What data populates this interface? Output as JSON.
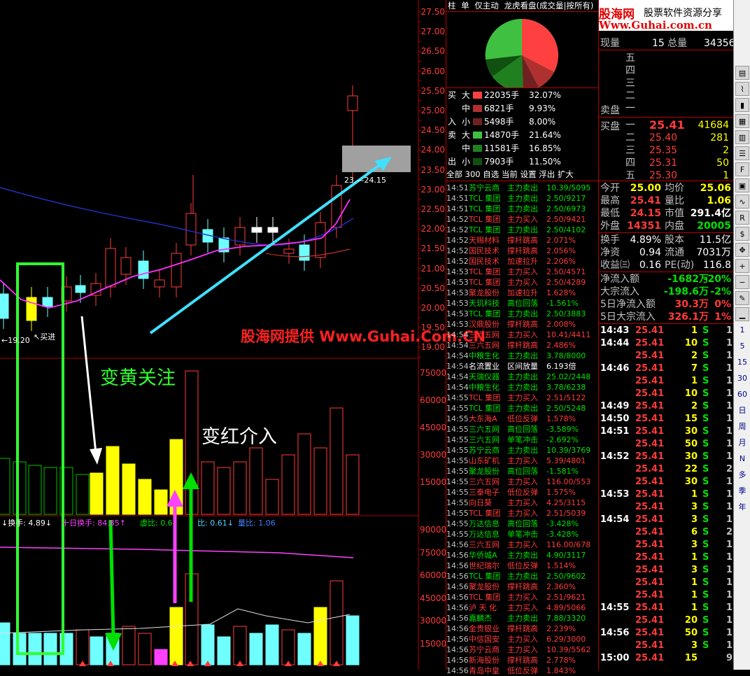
{
  "price_axis": [
    "27.50",
    "27.00",
    "26.50",
    "26.00",
    "25.50",
    "25.00",
    "24.50",
    "24.00",
    "23.50",
    "23.00",
    "22.50",
    "22.00",
    "21.50",
    "21.00",
    "20.50",
    "20.00",
    "19.50",
    "19.00"
  ],
  "vol_axis": [
    "75000",
    "60000",
    "45000",
    "30000",
    "15000"
  ],
  "turnover_axis": [
    "90000",
    "75000",
    "60000",
    "45000",
    "30000",
    "15000"
  ],
  "chart_labels": {
    "low_marker": "←19.20",
    "buy_marker": "↖买进",
    "range_label": "23.—24.15",
    "turnover_line": "↓换手: 4.89↓",
    "ten_day": "十日换手: 84.85↑",
    "xubi": "虚比: 0.6",
    "lbi": "比: 0.61↓",
    "liangbi": "量比: 1.06"
  },
  "annotations": {
    "yellow_note": "变黄关注",
    "red_note": "变红介入",
    "watermark": "股海网提供 Www.Guhai.Com.CN"
  },
  "logo": {
    "name": "股海网",
    "tagline": "股票软件资源分享",
    "url": "Www.Guhai.com.cn"
  },
  "mid_tabs": [
    "柱",
    "单",
    "仅主动",
    "龙虎看盘(成交量|按所有)"
  ],
  "flow": {
    "buy": [
      {
        "side": "买",
        "size": "大",
        "color": "#ff4040",
        "vol": "22035手",
        "pct": "32.07%"
      },
      {
        "side": "",
        "size": "中",
        "color": "#b03030",
        "vol": "6821手",
        "pct": "9.93%"
      },
      {
        "side": "入",
        "size": "小",
        "color": "#702020",
        "vol": "5498手",
        "pct": "8.00%"
      }
    ],
    "sell": [
      {
        "side": "卖",
        "size": "大",
        "color": "#40c040",
        "vol": "14870手",
        "pct": "21.64%"
      },
      {
        "side": "",
        "size": "中",
        "color": "#208020",
        "vol": "11581手",
        "pct": "16.85%"
      },
      {
        "side": "出",
        "size": "小",
        "color": "#105010",
        "vol": "7903手",
        "pct": "11.50%"
      }
    ]
  },
  "mid_bottom_tabs": [
    "全部",
    "300",
    "自选",
    "当前",
    "设置",
    "浮出",
    "扩大"
  ],
  "ticker": [
    [
      "14:51",
      "苏宁云商",
      "主力卖出",
      "10.39/5095",
      "g"
    ],
    [
      "14:51",
      "TCL 集团",
      "主力卖出",
      "2.50/9217",
      "g"
    ],
    [
      "14:51",
      "TCL 集团",
      "主力卖出",
      "2.50/6973",
      "g"
    ],
    [
      "14:52",
      "TCL 集团",
      "主力买入",
      "2.50/9421",
      "r"
    ],
    [
      "14:52",
      "TCL 集团",
      "主力卖出",
      "2.50/4102",
      "g"
    ],
    [
      "14:52",
      "天赐材料",
      "撑杆跳高",
      "2.071%",
      "r"
    ],
    [
      "14:52",
      "国民技术",
      "撑杆跳高",
      "2.056%",
      "r"
    ],
    [
      "14:52",
      "国民技术",
      "加速拉升",
      "2.206%",
      "r"
    ],
    [
      "14:53",
      "TCL 集团",
      "主力买入",
      "2.50/4571",
      "r"
    ],
    [
      "14:53",
      "TCL 集团",
      "主力买入",
      "2.50/4289",
      "r"
    ],
    [
      "14:53",
      "聚龙股份",
      "加速拉升",
      "1.628%",
      "r"
    ],
    [
      "14:53",
      "天玑科技",
      "高位回落",
      "-1.561%",
      "g"
    ],
    [
      "14:53",
      "TCL 集团",
      "主力卖出",
      "2.50/3883",
      "g"
    ],
    [
      "14:53",
      "汉鼎股份",
      "撑杆跳高",
      "2.008%",
      "r"
    ],
    [
      "14:54",
      "三六五网",
      "主力买入",
      "10.41/4411",
      "r"
    ],
    [
      "14:54",
      "三六五网",
      "撑杆跳高",
      "2.486%",
      "r"
    ],
    [
      "14:54",
      "中粮生化",
      "主力卖出",
      "3.78/8000",
      "g"
    ],
    [
      "14:54",
      "名流置业",
      "区间放量",
      "6.193倍",
      "w"
    ],
    [
      "14:54",
      "天瑞仪器",
      "主力卖出",
      "25.02/2448",
      "g"
    ],
    [
      "14:54",
      "中粮生化",
      "主力卖出",
      "3.78/6238",
      "g"
    ],
    [
      "14:55",
      "TCL 集团",
      "主力买入",
      "2.51/5122",
      "r"
    ],
    [
      "14:55",
      "TCL 集团",
      "主力卖出",
      "2.50/5248",
      "g"
    ],
    [
      "14:55",
      "大东海A",
      "低位反弹",
      "1.578%",
      "r"
    ],
    [
      "14:55",
      "三六五网",
      "高位回落",
      "-3.589%",
      "g"
    ],
    [
      "14:55",
      "三六五网",
      "单笔冲击",
      "-2.692%",
      "g"
    ],
    [
      "14:55",
      "苏宁云商",
      "主力卖出",
      "10.39/3769",
      "g"
    ],
    [
      "14:55",
      "山东矿机",
      "主力买入",
      "5.39/4801",
      "r"
    ],
    [
      "14:55",
      "聚龙股份",
      "高位回落",
      "-1.581%",
      "g"
    ],
    [
      "14:55",
      "三六五网",
      "主力买入",
      "116.00/553",
      "r"
    ],
    [
      "14:55",
      "三泰电子",
      "低位反弹",
      "1.575%",
      "r"
    ],
    [
      "14:55",
      "向日葵",
      "主力买入",
      "4.25/3115",
      "r"
    ],
    [
      "14:55",
      "TCL 集团",
      "主力买入",
      "2.51/5039",
      "r"
    ],
    [
      "14:55",
      "万达信息",
      "高位回落",
      "-3.428%",
      "g"
    ],
    [
      "14:55",
      "万达信息",
      "单笔冲击",
      "-3.428%",
      "g"
    ],
    [
      "14:56",
      "三六五网",
      "主力买入",
      "116.00/678",
      "r"
    ],
    [
      "14:56",
      "华侨城A",
      "主力卖出",
      "4.90/3117",
      "g"
    ],
    [
      "14:56",
      "世纪瑞尔",
      "低位反弹",
      "1.514%",
      "r"
    ],
    [
      "14:56",
      "TCL 集团",
      "主力卖出",
      "2.50/9602",
      "g"
    ],
    [
      "14:56",
      "聚龙股份",
      "撑杆跳高",
      "2.360%",
      "r"
    ],
    [
      "14:56",
      "TCL 集团",
      "主力买入",
      "2.51/9621",
      "r"
    ],
    [
      "14:56",
      "泸 天 化",
      "主力买入",
      "4.89/5066",
      "r"
    ],
    [
      "14:56",
      "嘉麟杰",
      "主力卖出",
      "7.88/3320",
      "g"
    ],
    [
      "14:56",
      "金贵银业",
      "撑杆跳高",
      "2.239%",
      "r"
    ],
    [
      "14:56",
      "中信国安",
      "主力买入",
      "6.29/3000",
      "r"
    ],
    [
      "14:56",
      "苏宁云商",
      "主力买入",
      "10.39/5562",
      "r"
    ],
    [
      "14:56",
      "新海股份",
      "撑杆跳高",
      "2.778%",
      "r"
    ],
    [
      "14:56",
      "青岛中皇",
      "低位反弹",
      "1.843%",
      "r"
    ]
  ],
  "quote_head": {
    "xl": "现量",
    "xv": "15",
    "zl": "总量",
    "zv": "34356"
  },
  "sell_levels": [
    "五",
    "四",
    "三",
    "二",
    "一"
  ],
  "sell_label": "卖盘",
  "buy_label": "买盘",
  "buy_levels": [
    {
      "lv": "一",
      "price": "25.41",
      "vol": "41684"
    },
    {
      "lv": "二",
      "price": "25.40",
      "vol": "281"
    },
    {
      "lv": "三",
      "price": "25.35",
      "vol": "2"
    },
    {
      "lv": "四",
      "price": "25.31",
      "vol": "50"
    },
    {
      "lv": "五",
      "price": "25.30",
      "vol": "1"
    }
  ],
  "stats": [
    {
      "l1": "今开",
      "v1": "25.00",
      "c1": "yellow",
      "l2": "均价",
      "v2": "25.06",
      "c2": "yellow"
    },
    {
      "l1": "最高",
      "v1": "25.41",
      "c1": "red",
      "l2": "量比",
      "v2": "1.06",
      "c2": "yellow"
    },
    {
      "l1": "最低",
      "v1": "24.15",
      "c1": "red",
      "l2": "市值",
      "v2": "291.4亿",
      "c2": "white"
    },
    {
      "l1": "外盘",
      "v1": "14351",
      "c1": "red",
      "l2": "内盘",
      "v2": "20005",
      "c2": "green"
    }
  ],
  "stats2": [
    {
      "l1": "换手",
      "v1": "4.89%",
      "l2": "股本",
      "v2": "11.5亿"
    },
    {
      "l1": "净资",
      "v1": "0.94",
      "l2": "流通",
      "v2": "7031万"
    },
    {
      "l1": "收益㈢",
      "v1": "0.16",
      "l2": "PE(动)",
      "v2": "116.8"
    }
  ],
  "money": [
    {
      "l": "净流入额",
      "v": "-1682万",
      "p": "-20%",
      "c": "green"
    },
    {
      "l": "大宗流入",
      "v": "-198.6万",
      "p": "-2%",
      "c": "green"
    },
    {
      "l": "5日净流入额",
      "v": "30.3万",
      "p": "0%",
      "c": "red"
    },
    {
      "l": "5日大宗流入",
      "v": "326.1万",
      "p": "1%",
      "c": "red"
    }
  ],
  "trades": [
    [
      "14:43",
      "25.41",
      "1",
      "S",
      "1"
    ],
    [
      "14:44",
      "25.41",
      "10",
      "S",
      "1"
    ],
    [
      "",
      "25.41",
      "2",
      "S",
      "1"
    ],
    [
      "14:46",
      "25.41",
      "7",
      "S",
      "1"
    ],
    [
      "",
      "25.41",
      "1",
      "S",
      "1"
    ],
    [
      "",
      "25.41",
      "10",
      "S",
      "1"
    ],
    [
      "14:49",
      "25.41",
      "2",
      "S",
      "1"
    ],
    [
      "14:50",
      "25.41",
      "15",
      "S",
      "1"
    ],
    [
      "14:51",
      "25.41",
      "30",
      "S",
      "1"
    ],
    [
      "",
      "25.41",
      "50",
      "S",
      "1"
    ],
    [
      "14:52",
      "25.41",
      "30",
      "S",
      "1"
    ],
    [
      "",
      "25.41",
      "22",
      "S",
      "2"
    ],
    [
      "",
      "25.41",
      "30",
      "S",
      "1"
    ],
    [
      "14:53",
      "25.41",
      "1",
      "S",
      "1"
    ],
    [
      "",
      "25.41",
      "3",
      "S",
      "1"
    ],
    [
      "14:54",
      "25.41",
      "3",
      "S",
      "1"
    ],
    [
      "",
      "25.41",
      "6",
      "S",
      "2"
    ],
    [
      "",
      "25.41",
      "3",
      "S",
      "1"
    ],
    [
      "",
      "25.41",
      "1",
      "S",
      "1"
    ],
    [
      "",
      "25.41",
      "3",
      "S",
      "1"
    ],
    [
      "",
      "25.41",
      "1",
      "S",
      "1"
    ],
    [
      "",
      "25.41",
      "1",
      "S",
      "1"
    ],
    [
      "14:55",
      "25.41",
      "1",
      "S",
      "1"
    ],
    [
      "",
      "25.41",
      "20",
      "S",
      "1"
    ],
    [
      "14:56",
      "25.41",
      "50",
      "S",
      "1"
    ],
    [
      "",
      "25.41",
      "3",
      "S",
      "1"
    ],
    [
      "15:00",
      "25.41",
      "15",
      "",
      "9"
    ]
  ],
  "toolbar": [
    "1",
    "5",
    "15",
    "30",
    "60",
    "日",
    "周",
    "月",
    "N",
    "多",
    "季",
    "年"
  ]
}
